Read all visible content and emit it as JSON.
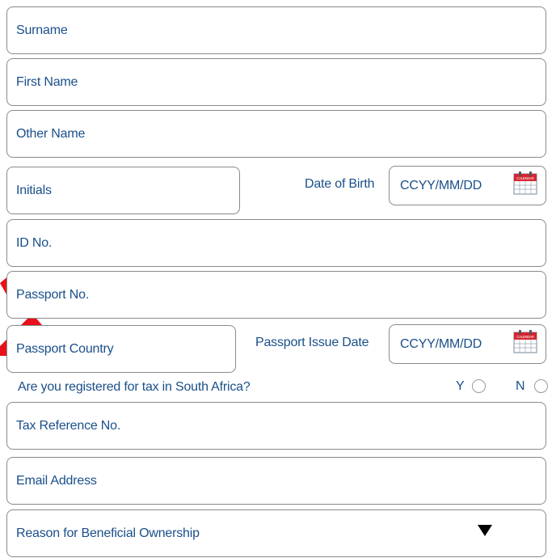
{
  "fields": {
    "surname": "Surname",
    "first_name": "First Name",
    "other_name": "Other Name",
    "initials": "Initials",
    "id_no": "ID No.",
    "passport_no": "Passport No.",
    "passport_country": "Passport Country",
    "tax_reference": "Tax Reference No.",
    "email": "Email Address",
    "reason": "Reason for Beneficial Ownership"
  },
  "dob": {
    "label": "Date of Birth",
    "placeholder": "CCYY/MM/DD"
  },
  "passport_issue": {
    "label": "Passport Issue Date",
    "placeholder": "CCYY/MM/DD"
  },
  "tax_question": {
    "text": "Are you registered for tax in South Africa?",
    "yes": "Y",
    "no": "N"
  },
  "calendar_icon_text": "CALENDAR",
  "colors": {
    "text": "#1a4f8a",
    "annotation": "#e8101a",
    "calendar_red": "#d62630"
  }
}
